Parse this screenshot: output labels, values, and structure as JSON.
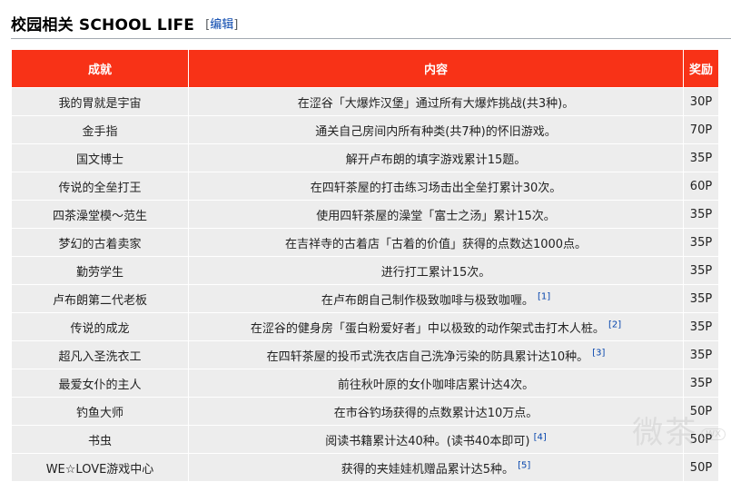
{
  "section": {
    "title": "校园相关 SCHOOL LIFE",
    "edit_open": "[",
    "edit_label": "编辑",
    "edit_close": "]"
  },
  "table": {
    "headers": [
      "成就",
      "内容",
      "奖励"
    ],
    "header_color": "#f83217",
    "rows": [
      {
        "name": "我的胃就是宇宙",
        "desc": "在涩谷「大爆炸汉堡」通过所有大爆炸挑战(共3种)。",
        "ref": "",
        "reward": "30P"
      },
      {
        "name": "金手指",
        "desc": "通关自己房间内所有种类(共7种)的怀旧游戏。",
        "ref": "",
        "reward": "70P"
      },
      {
        "name": "国文博士",
        "desc": "解开卢布朗的填字游戏累计15题。",
        "ref": "",
        "reward": "35P"
      },
      {
        "name": "传说的全垒打王",
        "desc": "在四轩茶屋的打击练习场击出全垒打累计30次。",
        "ref": "",
        "reward": "60P"
      },
      {
        "name": "四茶澡堂模～范生",
        "desc": "使用四轩茶屋的澡堂「富士之汤」累计15次。",
        "ref": "",
        "reward": "35P"
      },
      {
        "name": "梦幻的古着卖家",
        "desc": "在吉祥寺的古着店「古着的价值」获得的点数达1000点。",
        "ref": "",
        "reward": "35P"
      },
      {
        "name": "勤劳学生",
        "desc": "进行打工累计15次。",
        "ref": "",
        "reward": "35P"
      },
      {
        "name": "卢布朗第二代老板",
        "desc": "在卢布朗自己制作极致咖啡与极致咖喱。",
        "ref": "[1]",
        "reward": "35P"
      },
      {
        "name": "传说的成龙",
        "desc": "在涩谷的健身房「蛋白粉爱好者」中以极致的动作架式击打木人桩。",
        "ref": "[2]",
        "reward": "35P"
      },
      {
        "name": "超凡入圣洗衣工",
        "desc": "在四轩茶屋的投币式洗衣店自己洗净污染的防具累计达10种。",
        "ref": "[3]",
        "reward": "35P"
      },
      {
        "name": "最爱女仆的主人",
        "desc": "前往秋叶原的女仆咖啡店累计达4次。",
        "ref": "",
        "reward": "35P"
      },
      {
        "name": "钓鱼大师",
        "desc": "在市谷钓场获得的点数累计达10万点。",
        "ref": "",
        "reward": "50P"
      },
      {
        "name": "书虫",
        "desc": "阅读书籍累计达40种。(读书40本即可)",
        "ref": "[4]",
        "reward": "50P"
      },
      {
        "name": "WE☆LOVE游戏中心",
        "desc": "获得的夹娃娃机赠品累计达5种。",
        "ref": "[5]",
        "reward": "50P"
      }
    ]
  },
  "watermark": {
    "text": "微茶",
    "url": "WX"
  }
}
